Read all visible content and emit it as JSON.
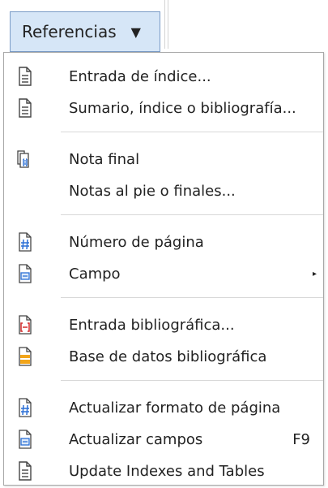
{
  "menubar": {
    "menu_label": "Referencias",
    "arrow": "▼"
  },
  "menu": {
    "items": [
      {
        "label": "Entrada de índice...",
        "icon": "index-entry-icon"
      },
      {
        "label": "Sumario, índice o bibliografía...",
        "icon": "table-of-contents-icon"
      },
      {
        "label": "Nota final",
        "icon": "endnote-icon"
      },
      {
        "label": "Notas al pie o finales...",
        "icon": ""
      },
      {
        "label": "Número de página",
        "icon": "page-number-icon"
      },
      {
        "label": "Campo",
        "icon": "field-icon",
        "submenu": "▸"
      },
      {
        "label": "Entrada bibliográfica...",
        "icon": "bibliography-entry-icon"
      },
      {
        "label": "Base de datos bibliográfica",
        "icon": "bibliography-database-icon"
      },
      {
        "label": "Actualizar formato de página",
        "icon": "update-page-format-icon"
      },
      {
        "label": "Actualizar campos",
        "icon": "update-fields-icon",
        "shortcut": "F9"
      },
      {
        "label": "Update Indexes and Tables",
        "icon": "update-indexes-icon"
      }
    ]
  }
}
